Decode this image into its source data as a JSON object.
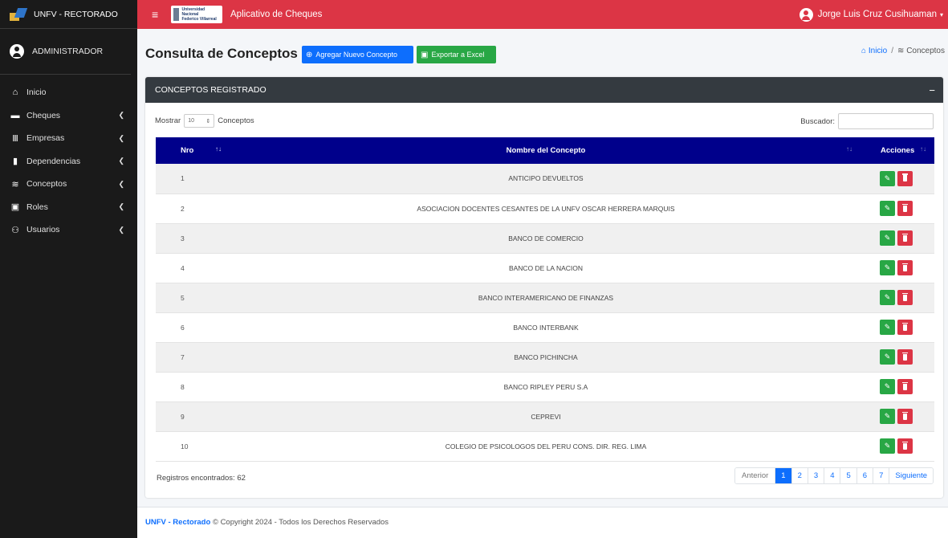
{
  "brand": {
    "title": "UNFV - RECTORADO"
  },
  "user_panel": {
    "name": "ADMINISTRADOR"
  },
  "sidebar": {
    "items": [
      {
        "label": "Inicio",
        "icon": "home-icon",
        "glyph": "⌂",
        "has_caret": false
      },
      {
        "label": "Cheques",
        "icon": "money-check-icon",
        "glyph": "▬",
        "has_caret": true
      },
      {
        "label": "Empresas",
        "icon": "landmark-icon",
        "glyph": "Ⅲ",
        "has_caret": true
      },
      {
        "label": "Dependencias",
        "icon": "bookmark-icon",
        "glyph": "▮",
        "has_caret": true
      },
      {
        "label": "Conceptos",
        "icon": "layer-group-icon",
        "glyph": "≋",
        "has_caret": true
      },
      {
        "label": "Roles",
        "icon": "id-card-icon",
        "glyph": "▣",
        "has_caret": true
      },
      {
        "label": "Usuarios",
        "icon": "users-icon",
        "glyph": "⚇",
        "has_caret": true
      }
    ]
  },
  "topbar": {
    "logo_text_1": "Universidad Nacional",
    "logo_text_2": "Federico Villarreal",
    "app_title": "Aplicativo de Cheques",
    "user_name": "Jorge Luis Cruz Cusihuaman"
  },
  "header": {
    "title": "Consulta de Conceptos",
    "add_button": "Agregar Nuevo Concepto",
    "excel_button": "Exportar a Excel",
    "breadcrumb_home": "Inicio",
    "breadcrumb_current": "Conceptos"
  },
  "card": {
    "title": "CONCEPTOS REGISTRADO",
    "show_label": "Mostrar",
    "page_length": "10",
    "show_suffix": "Conceptos",
    "search_label": "Buscador:",
    "search_value": ""
  },
  "table": {
    "columns": [
      "Nro",
      "Nombre del Concepto",
      "Acciones"
    ],
    "rows": [
      {
        "nro": "1",
        "name": "ANTICIPO DEVUELTOS"
      },
      {
        "nro": "2",
        "name": "ASOCIACION DOCENTES CESANTES DE LA UNFV OSCAR HERRERA MARQUIS"
      },
      {
        "nro": "3",
        "name": "BANCO DE COMERCIO"
      },
      {
        "nro": "4",
        "name": "BANCO DE LA NACION"
      },
      {
        "nro": "5",
        "name": "BANCO INTERAMERICANO DE FINANZAS"
      },
      {
        "nro": "6",
        "name": "BANCO INTERBANK"
      },
      {
        "nro": "7",
        "name": "BANCO PICHINCHA"
      },
      {
        "nro": "8",
        "name": "BANCO RIPLEY PERU S.A"
      },
      {
        "nro": "9",
        "name": "CEPREVI"
      },
      {
        "nro": "10",
        "name": "COLEGIO DE PSICOLOGOS DEL PERU CONS. DIR. REG. LIMA"
      }
    ]
  },
  "footer_info": {
    "records": "Registros encontrados: 62"
  },
  "pagination": {
    "previous": "Anterior",
    "pages": [
      "1",
      "2",
      "3",
      "4",
      "5",
      "6",
      "7"
    ],
    "active": "1",
    "next": "Siguiente"
  },
  "footer": {
    "brand": "UNFV - Rectorado",
    "copyright": "© Copyright 2024 - Todos los Derechos Reservados"
  },
  "colors": {
    "topbar": "#dc3545",
    "sidebar": "#1a1a1a",
    "table_header": "#00008b",
    "card_header": "#343a40",
    "primary": "#0d6efd",
    "success": "#28a745",
    "danger": "#dc3545"
  }
}
